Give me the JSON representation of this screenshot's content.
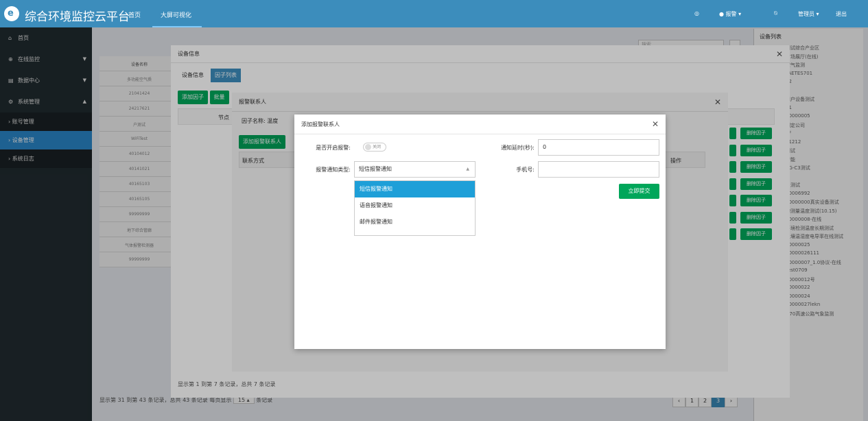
{
  "header": {
    "title": "综合环境监控云平台",
    "nav": [
      "首页",
      "大屏可视化"
    ],
    "alarm_label": "报警",
    "user_label": "管理员",
    "logout": "退出"
  },
  "sidebar": {
    "items": [
      {
        "label": "首页",
        "icon": "home-icon"
      },
      {
        "label": "在线监控",
        "icon": "globe-icon"
      },
      {
        "label": "数据中心",
        "icon": "calendar-icon"
      },
      {
        "label": "系统管理",
        "icon": "gear-icon"
      }
    ],
    "subitems": [
      {
        "label": "账号管理",
        "active": false
      },
      {
        "label": "设备管理",
        "active": true
      },
      {
        "label": "系统日志",
        "active": false
      }
    ]
  },
  "background": {
    "search_placeholder": "搜索",
    "col_header": "设备名称",
    "rows": [
      "多功能空气质",
      "21041424",
      "24217621",
      "户测试",
      "WiFiTest",
      "40104012",
      "40141021",
      "40165103",
      "40165105",
      "99999999",
      "地下综合管廊",
      "气体报警检测器",
      "99999999"
    ],
    "footer": "显示第 31 到第 43 条记录，总共 43 条记录 每页显示",
    "page_size": "15",
    "footer_suffix": "条记录",
    "pages": [
      "‹",
      "1",
      "2",
      "3",
      "›"
    ]
  },
  "right_panel": {
    "title": "设备列表",
    "items": [
      "测试综合产业区",
      "广场展厅(在线)",
      "空气监测",
      "FAETES701",
      "32",
      "3",
      "用户设备测试",
      "11",
      "10000005",
      "测定公司",
      "PF",
      "31212",
      "测试",
      "智能",
      "4G-C3测试",
      "3",
      "自测试",
      "20006992",
      "10000000真实设备测试",
      "的测量温度测试(10.15)",
      "10000008-在线",
      "环境检测温度长期测试",
      "土壤温湿度电导率在线测试",
      "10000025",
      "10000026111",
      "10000007_1.0协议-在线",
      "Test0709",
      "10000012号",
      "10000022",
      "10000024",
      "10000027lekn",
      "G70高速公路气象监测"
    ]
  },
  "modal1": {
    "title": "设备信息",
    "tabs": [
      "设备信息",
      "因子列表"
    ],
    "btn_add": "添加因子",
    "btn_batch": "批量",
    "col_node": "节点",
    "delete_label": "删除因子",
    "footer": "显示第 1 到第 7 条记录，总共 7 条记录"
  },
  "modal2": {
    "title": "报警联系人",
    "factor_label": "因子名称:",
    "factor_value": "温度",
    "btn_add": "添加报警联系人",
    "col_contact": "联系方式",
    "col_op": "操作"
  },
  "modal3": {
    "title": "添加报警联系人",
    "enable_label": "是否开启报警:",
    "toggle_text": "关闭",
    "type_label": "报警通知类型:",
    "type_value": "短信报警通知",
    "options": [
      "短信报警通知",
      "语音报警通知",
      "邮件报警通知"
    ],
    "delay_label": "通知延时(秒):",
    "delay_value": "0",
    "phone_label": "手机号:",
    "phone_value": "",
    "submit": "立即提交"
  }
}
